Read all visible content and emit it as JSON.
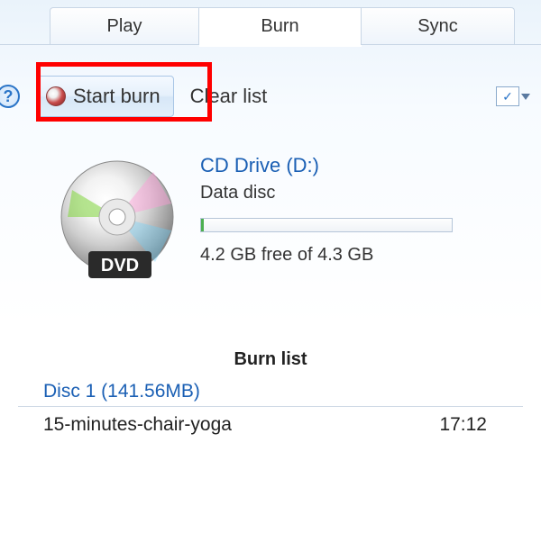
{
  "tabs": {
    "play": "Play",
    "burn": "Burn",
    "sync": "Sync"
  },
  "toolbar": {
    "start_burn": "Start burn",
    "clear_list": "Clear list"
  },
  "drive": {
    "name": "CD Drive (D:)",
    "type": "Data disc",
    "freespace": "4.2 GB free of 4.3 GB",
    "dvd_badge": "DVD"
  },
  "burnlist": {
    "title": "Burn list",
    "disc_label": "Disc 1 (141.56MB)",
    "tracks": [
      {
        "name": "15-minutes-chair-yoga",
        "duration": "17:12"
      }
    ]
  }
}
